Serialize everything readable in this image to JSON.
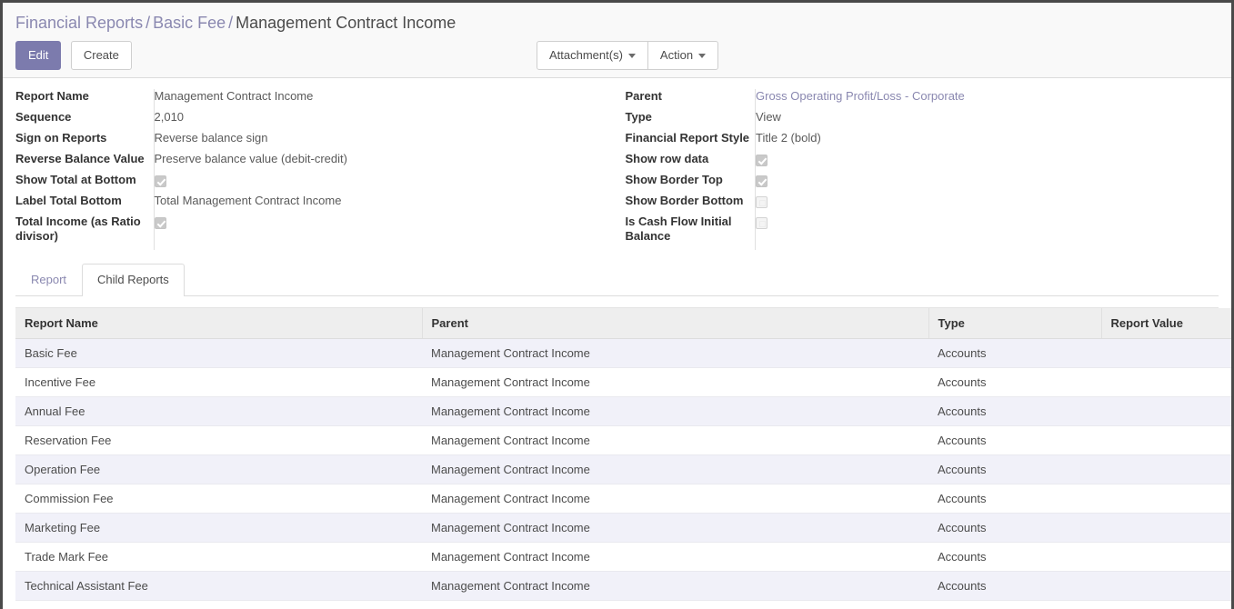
{
  "breadcrumb": {
    "root": "Financial Reports",
    "parent": "Basic Fee",
    "current": "Management Contract Income",
    "separator": "/"
  },
  "toolbar": {
    "edit_label": "Edit",
    "create_label": "Create",
    "attachments_label": "Attachment(s)",
    "action_label": "Action"
  },
  "colors": {
    "accent": "#7c7bad",
    "link": "#8a88b0",
    "header_bg": "#f9f9f9",
    "row_alt": "#f1f1f9",
    "table_header_bg": "#eeeeee"
  },
  "form": {
    "left": [
      {
        "label": "Report Name",
        "value": "Management Contract Income",
        "type": "text"
      },
      {
        "label": "Sequence",
        "value": "2,010",
        "type": "text"
      },
      {
        "label": "Sign on Reports",
        "value": "Reverse balance sign",
        "type": "text"
      },
      {
        "label": "Reverse Balance Value",
        "value": "Preserve balance value (debit-credit)",
        "type": "text"
      },
      {
        "label": "Show Total at Bottom",
        "value": "",
        "type": "checkbox",
        "checked": true
      },
      {
        "label": "Label Total Bottom",
        "value": "Total Management Contract Income",
        "type": "text"
      },
      {
        "label": "Total Income (as Ratio divisor)",
        "value": "",
        "type": "checkbox",
        "checked": true
      }
    ],
    "right": [
      {
        "label": "Parent",
        "value": "Gross Operating Profit/Loss - Corporate",
        "type": "link"
      },
      {
        "label": "Type",
        "value": "View",
        "type": "text"
      },
      {
        "label": "Financial Report Style",
        "value": "Title 2 (bold)",
        "type": "text"
      },
      {
        "label": "Show row data",
        "value": "",
        "type": "checkbox",
        "checked": true
      },
      {
        "label": "Show Border Top",
        "value": "",
        "type": "checkbox",
        "checked": true
      },
      {
        "label": "Show Border Bottom",
        "value": "",
        "type": "checkbox",
        "checked": false
      },
      {
        "label": "Is Cash Flow Initial Balance",
        "value": "",
        "type": "checkbox",
        "checked": false
      }
    ]
  },
  "notebook": {
    "tabs": [
      {
        "label": "Report",
        "active": false
      },
      {
        "label": "Child Reports",
        "active": true
      }
    ]
  },
  "child_reports": {
    "columns": [
      "Report Name",
      "Parent",
      "Type",
      "Report Value"
    ],
    "rows": [
      {
        "name": "Basic Fee",
        "parent": "Management Contract Income",
        "type": "Accounts",
        "value": ""
      },
      {
        "name": "Incentive Fee",
        "parent": "Management Contract Income",
        "type": "Accounts",
        "value": ""
      },
      {
        "name": "Annual Fee",
        "parent": "Management Contract Income",
        "type": "Accounts",
        "value": ""
      },
      {
        "name": "Reservation Fee",
        "parent": "Management Contract Income",
        "type": "Accounts",
        "value": ""
      },
      {
        "name": "Operation Fee",
        "parent": "Management Contract Income",
        "type": "Accounts",
        "value": ""
      },
      {
        "name": "Commission Fee",
        "parent": "Management Contract Income",
        "type": "Accounts",
        "value": ""
      },
      {
        "name": "Marketing Fee",
        "parent": "Management Contract Income",
        "type": "Accounts",
        "value": ""
      },
      {
        "name": "Trade Mark Fee",
        "parent": "Management Contract Income",
        "type": "Accounts",
        "value": ""
      },
      {
        "name": "Technical Assistant Fee",
        "parent": "Management Contract Income",
        "type": "Accounts",
        "value": ""
      }
    ]
  }
}
